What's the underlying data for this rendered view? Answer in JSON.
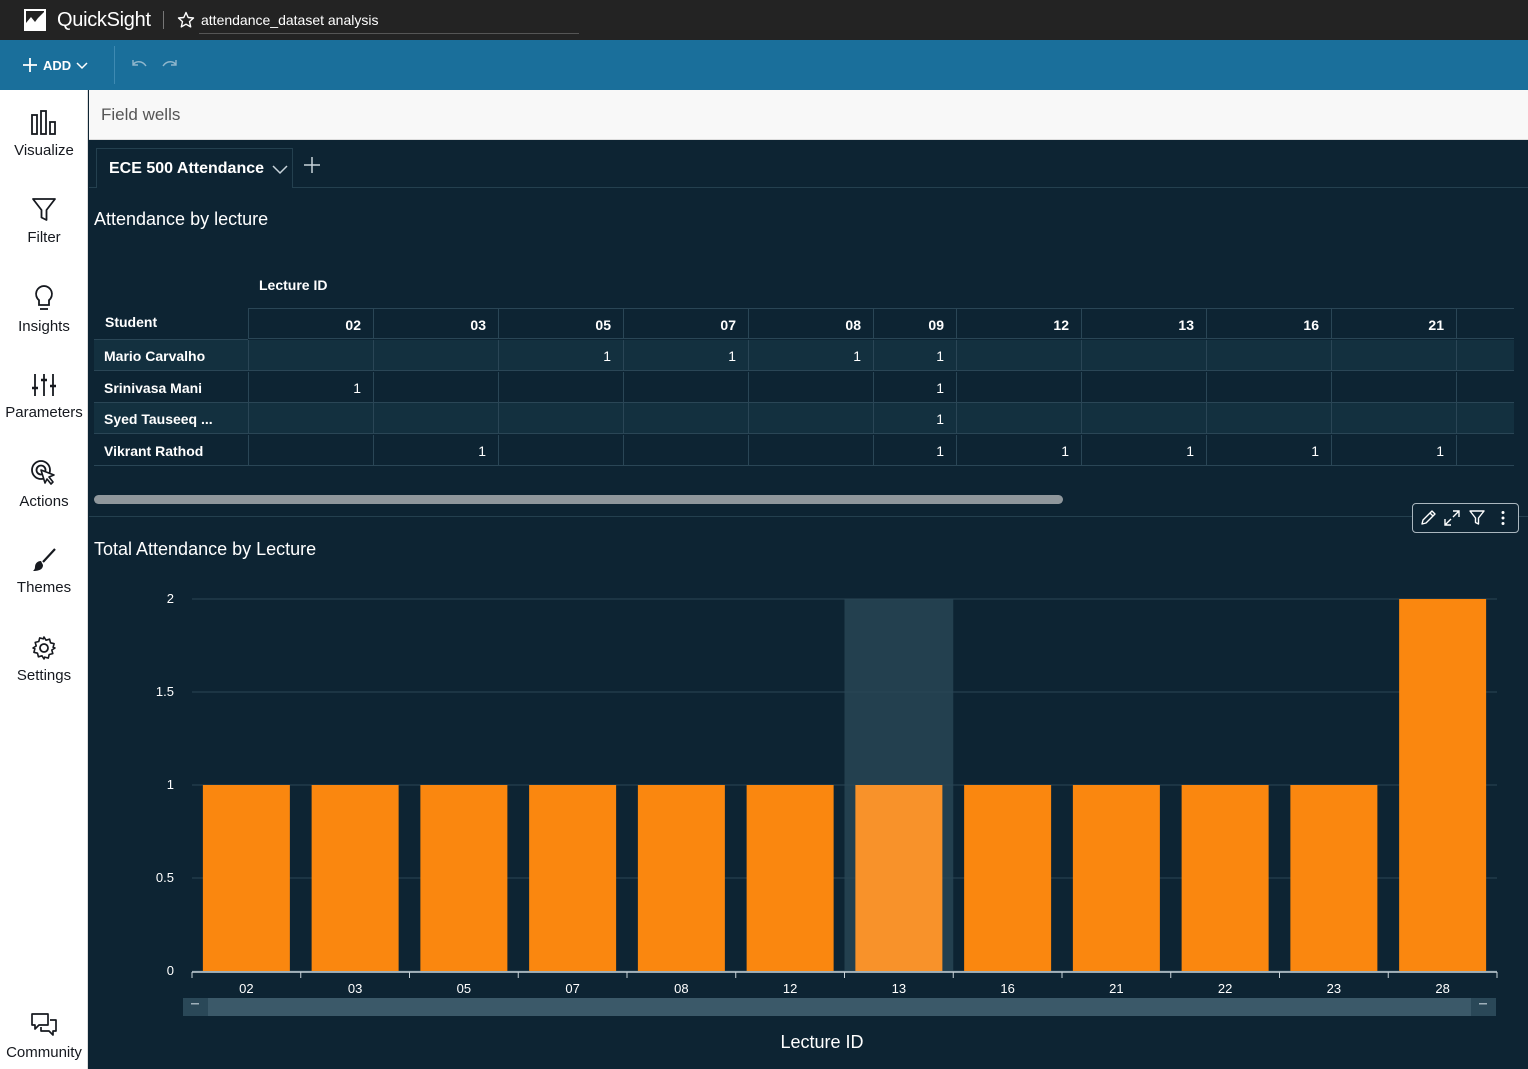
{
  "app": {
    "brand": "QuickSight",
    "analysis_name": "attendance_dataset analysis"
  },
  "toolbar": {
    "add_label": "ADD"
  },
  "sidebar": {
    "items": [
      {
        "label": "Visualize",
        "icon": "bar-chart-icon"
      },
      {
        "label": "Filter",
        "icon": "funnel-icon"
      },
      {
        "label": "Insights",
        "icon": "lightbulb-icon"
      },
      {
        "label": "Parameters",
        "icon": "sliders-icon"
      },
      {
        "label": "Actions",
        "icon": "cursor-click-icon"
      },
      {
        "label": "Themes",
        "icon": "brush-icon"
      },
      {
        "label": "Settings",
        "icon": "gear-icon"
      }
    ],
    "community_label": "Community"
  },
  "field_wells": {
    "label": "Field wells"
  },
  "sheet_tab": {
    "label": "ECE 500 Attendance"
  },
  "pivot": {
    "title": "Attendance by lecture",
    "column_field": "Lecture ID",
    "row_field": "Student",
    "columns": [
      "02",
      "03",
      "05",
      "07",
      "08",
      "09",
      "12",
      "13",
      "16",
      "21"
    ],
    "rows": [
      {
        "student": "Mario Carvalho",
        "values": [
          "",
          "",
          "1",
          "1",
          "1",
          "1",
          "",
          "",
          "",
          ""
        ]
      },
      {
        "student": "Srinivasa Mani",
        "values": [
          "1",
          "",
          "",
          "",
          "",
          "1",
          "",
          "",
          "",
          ""
        ]
      },
      {
        "student": "Syed Tauseeq ...",
        "values": [
          "",
          "",
          "",
          "",
          "",
          "1",
          "",
          "",
          "",
          ""
        ]
      },
      {
        "student": "Vikrant Rathod",
        "values": [
          "",
          "1",
          "",
          "",
          "",
          "1",
          "1",
          "1",
          "1",
          "1"
        ]
      }
    ]
  },
  "colors": {
    "bar": "#fa870f",
    "bar_highlight": "#f8922a",
    "background": "#0d2433",
    "toolbar": "#1a6f9b"
  },
  "chart_data": {
    "type": "bar",
    "title": "Total Attendance by Lecture",
    "xlabel": "Lecture ID",
    "ylabel": "",
    "categories": [
      "02",
      "03",
      "05",
      "07",
      "08",
      "12",
      "13",
      "16",
      "21",
      "22",
      "23",
      "28"
    ],
    "values": [
      1,
      1,
      1,
      1,
      1,
      1,
      1,
      1,
      1,
      1,
      1,
      2
    ],
    "ylim": [
      0,
      2
    ],
    "yticks": [
      "0",
      "0.5",
      "1",
      "1.5",
      "2"
    ],
    "highlighted_category": "13",
    "grid": true,
    "legend": "none"
  }
}
